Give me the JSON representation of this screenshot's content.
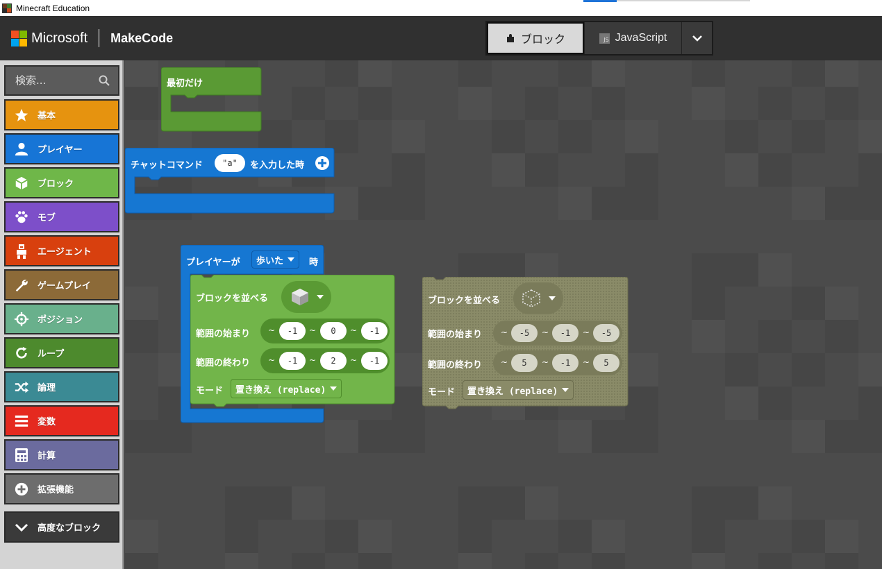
{
  "window": {
    "title": "Minecraft Education"
  },
  "header": {
    "brand": "Microsoft",
    "product": "MakeCode",
    "editor_toggle": {
      "blocks_label": "ブロック",
      "js_label": "JavaScript",
      "js_badge": "JS"
    }
  },
  "sidebar": {
    "search_placeholder": "検索...",
    "categories": [
      {
        "label": "基本",
        "icon": "star-icon",
        "color": "#e6930f"
      },
      {
        "label": "プレイヤー",
        "icon": "person-icon",
        "color": "#1775d6"
      },
      {
        "label": "ブロック",
        "icon": "cube-icon",
        "color": "#6fb749"
      },
      {
        "label": "モブ",
        "icon": "paw-icon",
        "color": "#7d4fc9"
      },
      {
        "label": "エージェント",
        "icon": "agent-icon",
        "color": "#d8400e"
      },
      {
        "label": "ゲームプレイ",
        "icon": "wrench-icon",
        "color": "#8c6a38"
      },
      {
        "label": "ポジション",
        "icon": "crosshair-icon",
        "color": "#69b08c"
      },
      {
        "label": "ループ",
        "icon": "loop-icon",
        "color": "#4d8a2d"
      },
      {
        "label": "論理",
        "icon": "shuffle-icon",
        "color": "#3b8a94"
      },
      {
        "label": "変数",
        "icon": "list-icon",
        "color": "#e5291f"
      },
      {
        "label": "計算",
        "icon": "calculator-icon",
        "color": "#6b6b9e"
      },
      {
        "label": "拡張機能",
        "icon": "plus-circle-icon",
        "color": "#6d6d6d"
      },
      {
        "label": "高度なブロック",
        "icon": "chevron-down-icon",
        "color": "#3a3a3a"
      }
    ]
  },
  "workspace": {
    "on_start": {
      "label": "最初だけ",
      "color": "#5a9a34"
    },
    "chat_command": {
      "label_before": "チャットコマンド",
      "value": "\"a\"",
      "label_after": "を入力した時",
      "color": "#1677d2"
    },
    "player_event": {
      "label_before": "プレイヤーが",
      "dropdown": "歩いた",
      "label_after": "時",
      "color": "#1677d2"
    },
    "fill_active": {
      "title": "ブロックを並べる",
      "from_label": "範囲の始まり",
      "from": [
        "-1",
        "0",
        "-1"
      ],
      "to_label": "範囲の終わり",
      "to": [
        "-1",
        "2",
        "-1"
      ],
      "mode_label": "モード",
      "mode": "置き換え (replace)",
      "tilde": "~",
      "color": "#72b54a"
    },
    "fill_disabled": {
      "title": "ブロックを並べる",
      "from_label": "範囲の始まり",
      "from": [
        "-5",
        "-1",
        "-5"
      ],
      "to_label": "範囲の終わり",
      "to": [
        "5",
        "-1",
        "5"
      ],
      "mode_label": "モード",
      "mode": "置き換え (replace)",
      "tilde": "~",
      "color": "#8a8b68"
    }
  }
}
